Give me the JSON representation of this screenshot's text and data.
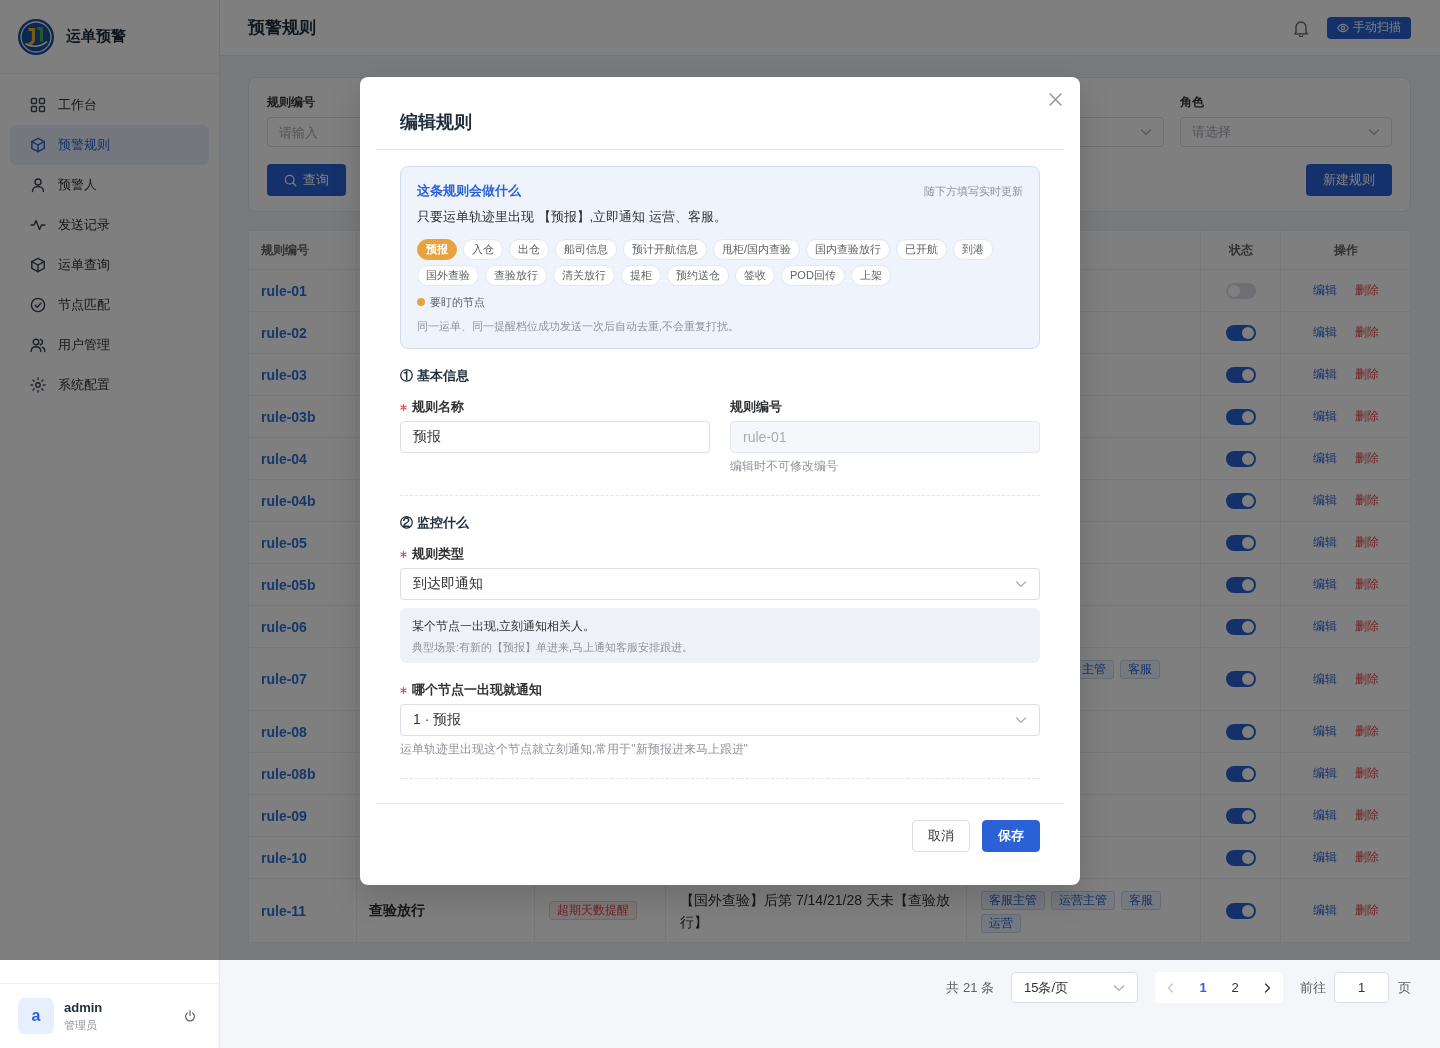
{
  "sidebar": {
    "brand": "运单预警",
    "items": [
      {
        "label": "工作台",
        "selected": false
      },
      {
        "label": "预警规则",
        "selected": true
      },
      {
        "label": "预警人",
        "selected": false
      },
      {
        "label": "发送记录",
        "selected": false
      },
      {
        "label": "运单查询",
        "selected": false
      },
      {
        "label": "节点匹配",
        "selected": false
      },
      {
        "label": "用户管理",
        "selected": false
      },
      {
        "label": "系统配置",
        "selected": false
      }
    ],
    "user": {
      "avatar": "a",
      "name": "admin",
      "role": "管理员"
    }
  },
  "header": {
    "title": "预警规则",
    "scan_button": "手动扫描"
  },
  "filters": {
    "fields": [
      {
        "kind": "input",
        "label": "规则编号",
        "placeholder": "请输入"
      },
      {
        "kind": "select"
      },
      {
        "kind": "select",
        "label": "角色",
        "placeholder": "请选择"
      }
    ],
    "search_button": "查询",
    "create_button": "新建规则"
  },
  "table": {
    "columns": [
      "规则编号",
      "状态",
      "操作"
    ],
    "rows": [
      {
        "id": "rule-01",
        "tall": false,
        "enabled": false,
        "edit": "编辑",
        "delete": "删除"
      },
      {
        "id": "rule-02",
        "tall": false,
        "enabled": true,
        "edit": "编辑",
        "delete": "删除"
      },
      {
        "id": "rule-03",
        "tall": false,
        "enabled": true,
        "edit": "编辑",
        "delete": "删除"
      },
      {
        "id": "rule-03b",
        "tall": false,
        "enabled": true,
        "edit": "编辑",
        "delete": "删除"
      },
      {
        "id": "rule-04",
        "tall": false,
        "enabled": true,
        "edit": "编辑",
        "delete": "删除"
      },
      {
        "id": "rule-04b",
        "tall": false,
        "enabled": true,
        "edit": "编辑",
        "delete": "删除"
      },
      {
        "id": "rule-05",
        "tall": false,
        "enabled": true,
        "edit": "编辑",
        "delete": "删除"
      },
      {
        "id": "rule-05b",
        "tall": false,
        "enabled": true,
        "edit": "编辑",
        "delete": "删除"
      },
      {
        "id": "rule-06",
        "tall": false,
        "enabled": true,
        "edit": "编辑",
        "delete": "删除"
      },
      {
        "id": "rule-07",
        "tall": true,
        "roles": [
          {
            "text": "主管",
            "cut": true
          },
          {
            "text": "客服",
            "cut": false
          }
        ],
        "enabled": true,
        "edit": "编辑",
        "delete": "删除"
      },
      {
        "id": "rule-08",
        "tall": false,
        "enabled": true,
        "edit": "编辑",
        "delete": "删除"
      },
      {
        "id": "rule-08b",
        "tall": false,
        "enabled": true,
        "edit": "编辑",
        "delete": "删除"
      },
      {
        "id": "rule-09",
        "tall": false,
        "enabled": true,
        "edit": "编辑",
        "delete": "删除"
      },
      {
        "id": "rule-10",
        "tall": false,
        "enabled": true,
        "edit": "编辑",
        "delete": "删除"
      },
      {
        "id": "rule-11",
        "tall": true,
        "name": "查验放行",
        "type": "超期天数提醒",
        "description": "【国外查验】后第 7/14/21/28 天未【查验放行】",
        "roles": [
          {
            "text": "客服主管",
            "cut": false
          },
          {
            "text": "运营主管",
            "cut": false
          },
          {
            "text": "客服",
            "cut": false
          },
          {
            "text": "运营",
            "cut": false
          }
        ],
        "enabled": true,
        "edit": "编辑",
        "delete": "删除"
      }
    ]
  },
  "pagination": {
    "total": "共 21 条",
    "page_size": "15条/页",
    "prev": {
      "disabled": true
    },
    "pages": [
      {
        "label": "1",
        "selected": true
      },
      {
        "label": "2",
        "selected": false
      }
    ],
    "next": {
      "disabled": false
    },
    "goto": "前往",
    "goto_value": "1",
    "suffix": "页"
  },
  "dialog": {
    "title": "编辑规则",
    "summary": {
      "title": "这条规则会做什么",
      "note": "随下方填写实时更新",
      "sentence": "只要运单轨迹里出现 【预报】,立即通知 运营、客服。",
      "nodes": [
        {
          "label": "预报",
          "selected": true
        },
        {
          "label": "入仓",
          "selected": false
        },
        {
          "label": "出仓",
          "selected": false
        },
        {
          "label": "船司信息",
          "selected": false
        },
        {
          "label": "预计开航信息",
          "selected": false
        },
        {
          "label": "甩柜/国内查验",
          "selected": false
        },
        {
          "label": "国内查验放行",
          "selected": false
        },
        {
          "label": "已开航",
          "selected": false
        },
        {
          "label": "到港",
          "selected": false
        },
        {
          "label": "国外查验",
          "selected": false
        },
        {
          "label": "查验放行",
          "selected": false
        },
        {
          "label": "清关放行",
          "selected": false
        },
        {
          "label": "提柜",
          "selected": false
        },
        {
          "label": "预约送仓",
          "selected": false
        },
        {
          "label": "签收",
          "selected": false
        },
        {
          "label": "POD回传",
          "selected": false
        },
        {
          "label": "上架",
          "selected": false
        }
      ],
      "legend": "要盯的节点",
      "footnote": "同一运单、同一提醒档位成功发送一次后自动去重,不会重复打扰。"
    },
    "sections": [
      {
        "title": "① 基本信息",
        "items": [
          {
            "kind": "row",
            "fields": [
              {
                "kind": "input",
                "label": "规则名称",
                "required": true,
                "disabled": false,
                "value": "预报"
              },
              {
                "kind": "input",
                "label": "规则编号",
                "required": false,
                "disabled": true,
                "value": "rule-01",
                "hint": "编辑时不可修改编号"
              }
            ]
          }
        ]
      },
      {
        "title": "② 监控什么",
        "items": [
          {
            "kind": "select",
            "label": "规则类型",
            "required": true,
            "disabled": false,
            "value": "到达即通知"
          },
          {
            "kind": "info",
            "text": "某个节点一出现,立刻通知相关人。",
            "example": "典型场景:有新的【预报】单进来,马上通知客服安排跟进。"
          },
          {
            "kind": "select",
            "label": "哪个节点一出现就通知",
            "required": true,
            "disabled": false,
            "value": "1 · 预报",
            "hint": "运单轨迹里出现这个节点就立刻通知,常用于\"新预报进来马上跟进\""
          }
        ]
      }
    ],
    "buttons": [
      {
        "kind": "cancel",
        "label": "取消"
      },
      {
        "kind": "save",
        "label": "保存"
      }
    ]
  }
}
